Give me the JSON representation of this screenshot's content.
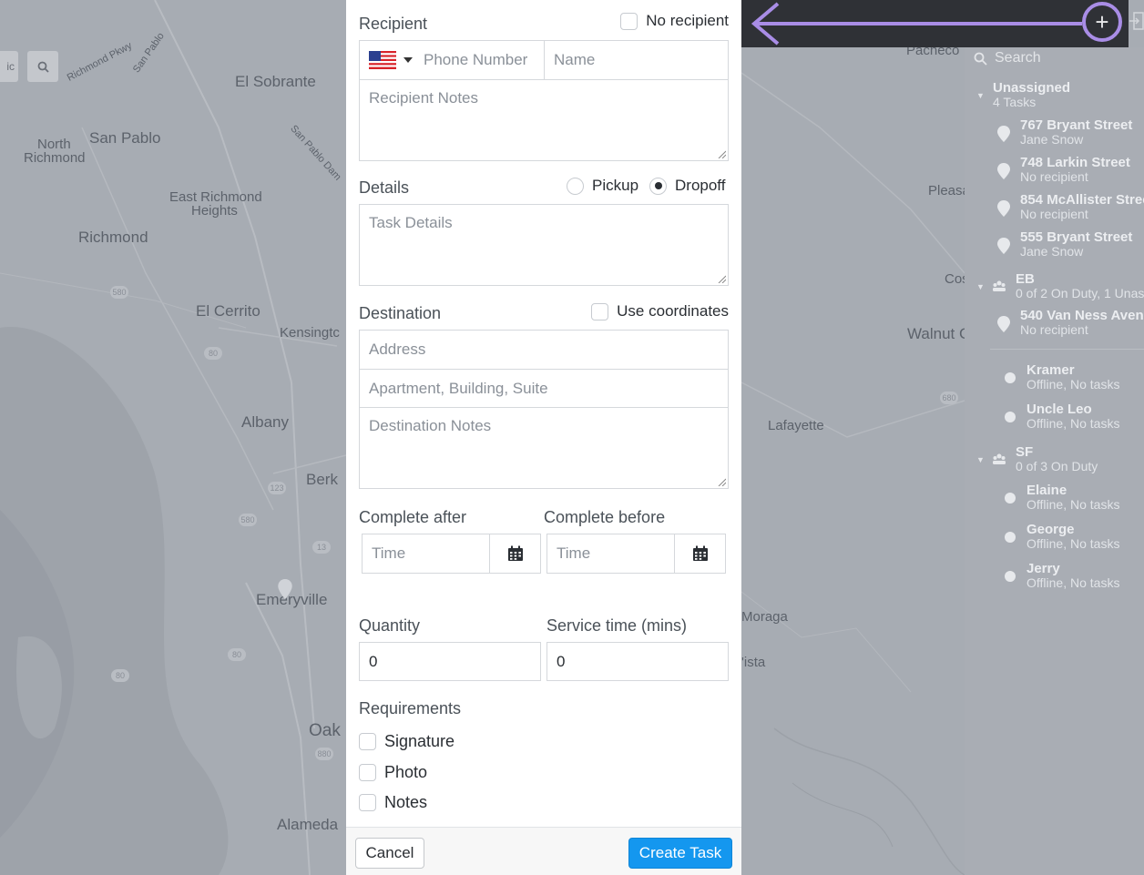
{
  "map": {
    "labels": [
      "El Sobrante",
      "Richmond Pkwy",
      "San Pablo",
      "North",
      "Richmond",
      "San Pablo",
      "San Pablo Dam",
      "East Richmond",
      "Heights",
      "Richmond",
      "El Cerrito",
      "Kensingtc",
      "Albany",
      "Berk",
      "Emeryville",
      "Oak",
      "Alameda",
      "Pacheco",
      "Pleasa",
      "Cos",
      "Walnut C",
      "Lafayette",
      "Moraga",
      "'ista"
    ],
    "shields": [
      "580",
      "80",
      "580",
      "123",
      "13",
      "80",
      "880",
      "80",
      "680"
    ],
    "partial_button": "ic",
    "search_icon": "search-icon"
  },
  "topbar": {
    "add_icon": "plus-icon",
    "logout_icon": "logout-icon",
    "arrow_color": "#a98de6"
  },
  "panel": {
    "search_placeholder": "Search",
    "unassigned_title": "Unassigned",
    "unassigned_count": "4 Tasks",
    "unassigned_tasks": [
      {
        "address": "767 Bryant Street",
        "recipient": "Jane Snow"
      },
      {
        "address": "748 Larkin Street",
        "recipient": "No recipient"
      },
      {
        "address": "854 McAllister Stree",
        "recipient": "No recipient"
      },
      {
        "address": "555 Bryant Street",
        "recipient": "Jane Snow"
      }
    ],
    "team_eb": {
      "name": "EB",
      "status": "0 of 2 On Duty, 1 Unas",
      "tasks": [
        {
          "address": "540 Van Ness Avenu",
          "recipient": "No recipient"
        }
      ],
      "drivers": [
        {
          "name": "Kramer",
          "status": "Offline, No tasks"
        },
        {
          "name": "Uncle Leo",
          "status": "Offline, No tasks"
        }
      ]
    },
    "team_sf": {
      "name": "SF",
      "status": "0 of 3 On Duty",
      "drivers": [
        {
          "name": "Elaine",
          "status": "Offline, No tasks"
        },
        {
          "name": "George",
          "status": "Offline, No tasks"
        },
        {
          "name": "Jerry",
          "status": "Offline, No tasks"
        }
      ]
    }
  },
  "form": {
    "recipient_label": "Recipient",
    "no_recipient_label": "No recipient",
    "phone_placeholder": "Phone Number",
    "name_placeholder": "Name",
    "recipient_notes_placeholder": "Recipient Notes",
    "details_label": "Details",
    "pickup_label": "Pickup",
    "dropoff_label": "Dropoff",
    "selected_type": "Dropoff",
    "task_details_placeholder": "Task Details",
    "destination_label": "Destination",
    "use_coordinates_label": "Use coordinates",
    "address_placeholder": "Address",
    "apartment_placeholder": "Apartment, Building, Suite",
    "destination_notes_placeholder": "Destination Notes",
    "complete_after_label": "Complete after",
    "complete_before_label": "Complete before",
    "time_placeholder": "Time",
    "quantity_label": "Quantity",
    "quantity_value": "0",
    "service_time_label": "Service time (mins)",
    "service_time_value": "0",
    "requirements_label": "Requirements",
    "requirements": [
      "Signature",
      "Photo",
      "Notes"
    ],
    "cancel_label": "Cancel",
    "create_label": "Create Task",
    "create_color": "#1497ef"
  }
}
